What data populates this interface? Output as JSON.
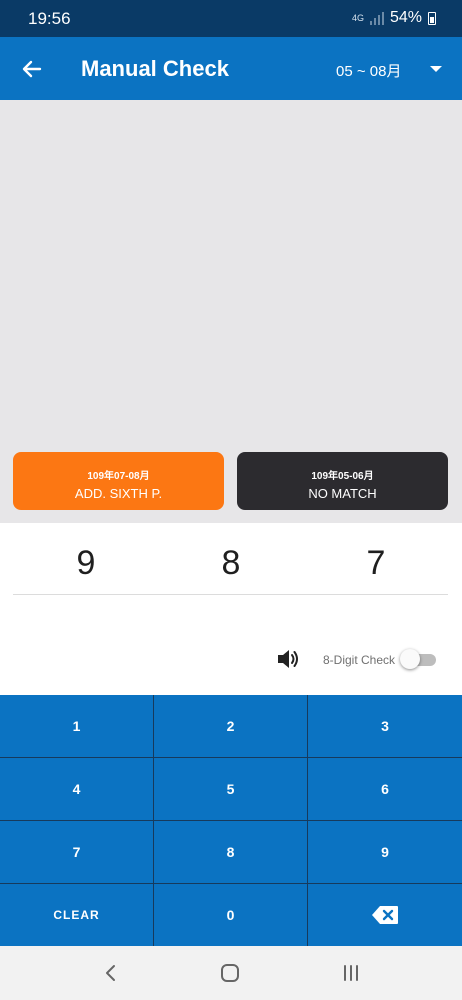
{
  "status_bar": {
    "time": "19:56",
    "network": "4G",
    "battery": "54%"
  },
  "header": {
    "title": "Manual Check",
    "period": "05 ~ 08月",
    "back_icon": "arrow-left-icon",
    "dropdown_icon": "caret-down-icon"
  },
  "results": [
    {
      "period": "109年07-08月",
      "status": "ADD. SIXTH P.",
      "color": "#fc7713"
    },
    {
      "period": "109年05-06月",
      "status": "NO MATCH",
      "color": "#2c2b2f"
    }
  ],
  "entered_digits": [
    "9",
    "8",
    "7"
  ],
  "options": {
    "sound_icon": "speaker-icon",
    "eight_digit_label": "8-Digit Check",
    "eight_digit_enabled": false
  },
  "keypad": {
    "keys": [
      "1",
      "2",
      "3",
      "4",
      "5",
      "6",
      "7",
      "8",
      "9",
      "CLEAR",
      "0"
    ],
    "backspace_icon": "backspace-icon"
  },
  "colors": {
    "primary": "#0b73c2",
    "status_bar": "#0a3a66",
    "accent_orange": "#fc7713",
    "dark_card": "#2c2b2f"
  }
}
